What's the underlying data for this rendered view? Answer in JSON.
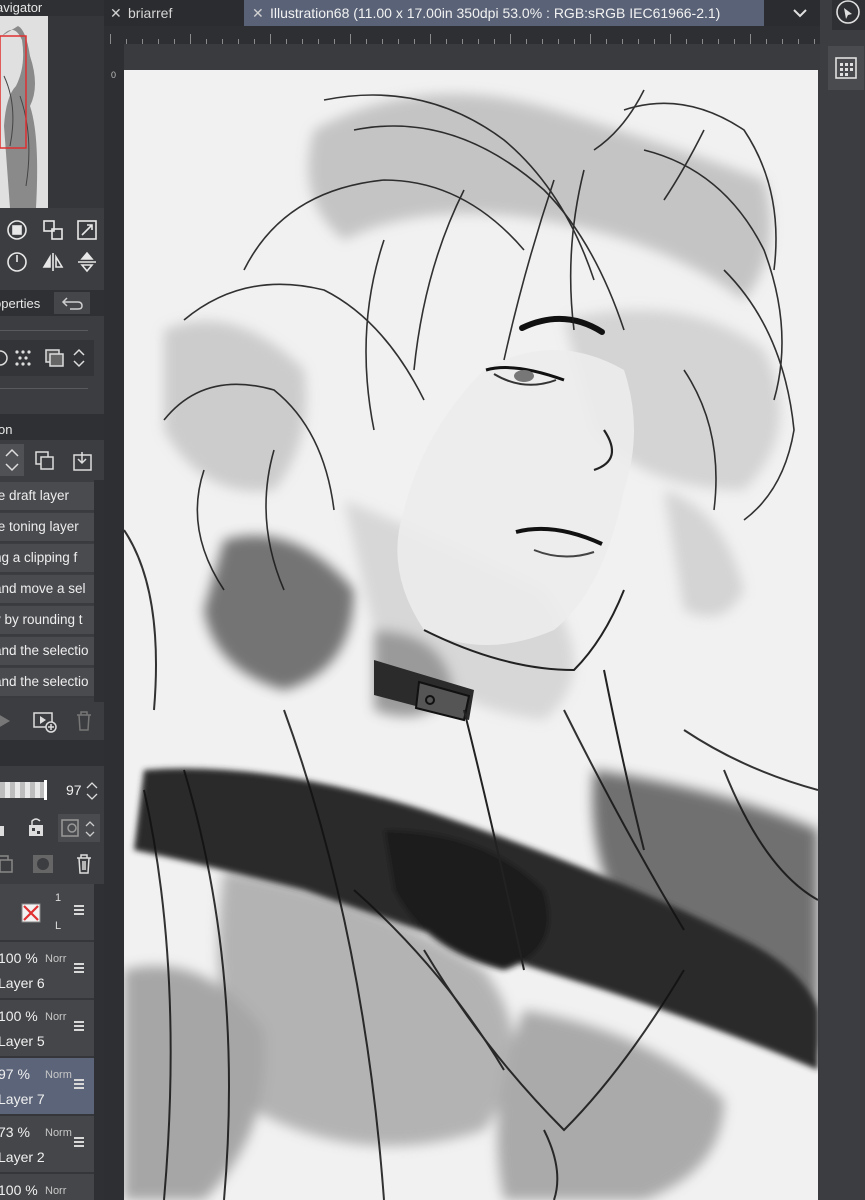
{
  "tabs": [
    {
      "label": "briarref",
      "active": false
    },
    {
      "label": "Illustration68 (11.00 x 17.00in 350dpi 53.0% : RGB:sRGB IEC61966-2.1)",
      "active": true
    }
  ],
  "tab_overflow_icon": "chevron-down-icon",
  "navigator": {
    "title": "avigator"
  },
  "properties_panel": {
    "title": "operties"
  },
  "auto_action": {
    "title": "on",
    "items": [
      "te draft layer",
      "te toning layer",
      "ng a clipping f",
      "and move a sel",
      "y by rounding t",
      "and the selectio",
      "and the selectio"
    ]
  },
  "layer_panel": {
    "opacity_value": "97",
    "top_layer_icon_text": "1",
    "top_layer_sub_text": "L",
    "layers": [
      {
        "opacity": "100 %",
        "mode": "Norr",
        "name": "Layer 6",
        "selected": false
      },
      {
        "opacity": "100 %",
        "mode": "Norr",
        "name": "Layer 5",
        "selected": false
      },
      {
        "opacity": "97 %",
        "mode": "Norm",
        "name": "Layer 7",
        "selected": true
      },
      {
        "opacity": "73 %",
        "mode": "Norm",
        "name": "Layer 2",
        "selected": false
      },
      {
        "opacity": "100 %",
        "mode": "Norr",
        "name": "",
        "selected": false
      }
    ]
  },
  "ruler_origin_label": "0",
  "colors": {
    "panel_bg": "#3c3d40",
    "active_tab": "#596277",
    "selected_layer": "#5b6479",
    "canvas": "#f1f1f1"
  }
}
